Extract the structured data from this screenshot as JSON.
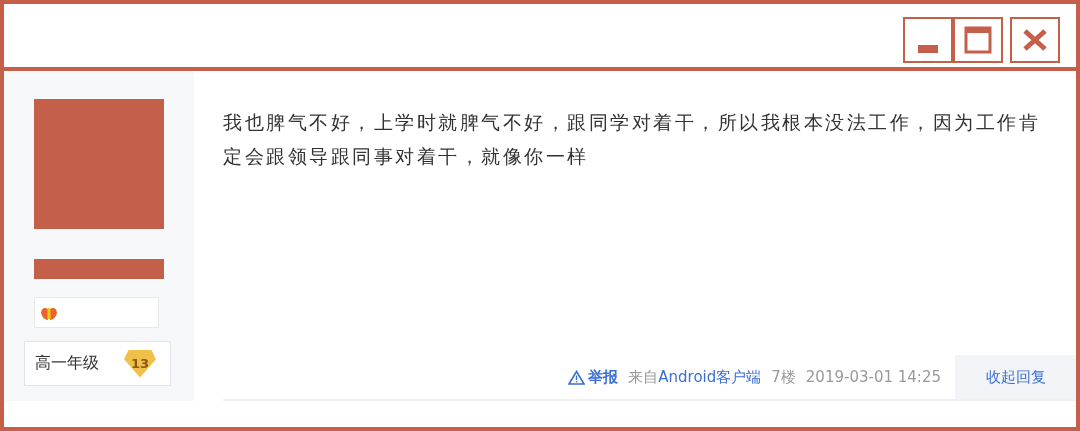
{
  "window": {
    "controls": [
      {
        "kind": "minimize"
      },
      {
        "kind": "maximize"
      },
      {
        "kind": "close"
      }
    ]
  },
  "author": {
    "rank": "高一年级",
    "level": "13"
  },
  "post": {
    "text": "我也脾气不好，上学时就脾气不好，跟同学对着干，所以我根本没法工作，因为工作肯定会跟领导跟同事对着干，就像你一样"
  },
  "footer": {
    "report": "举报",
    "source_prefix": "来自",
    "source_link": "Android客户端",
    "floor": "7楼",
    "time": "2019-03-01 14:25",
    "collapse": "收起回复"
  }
}
